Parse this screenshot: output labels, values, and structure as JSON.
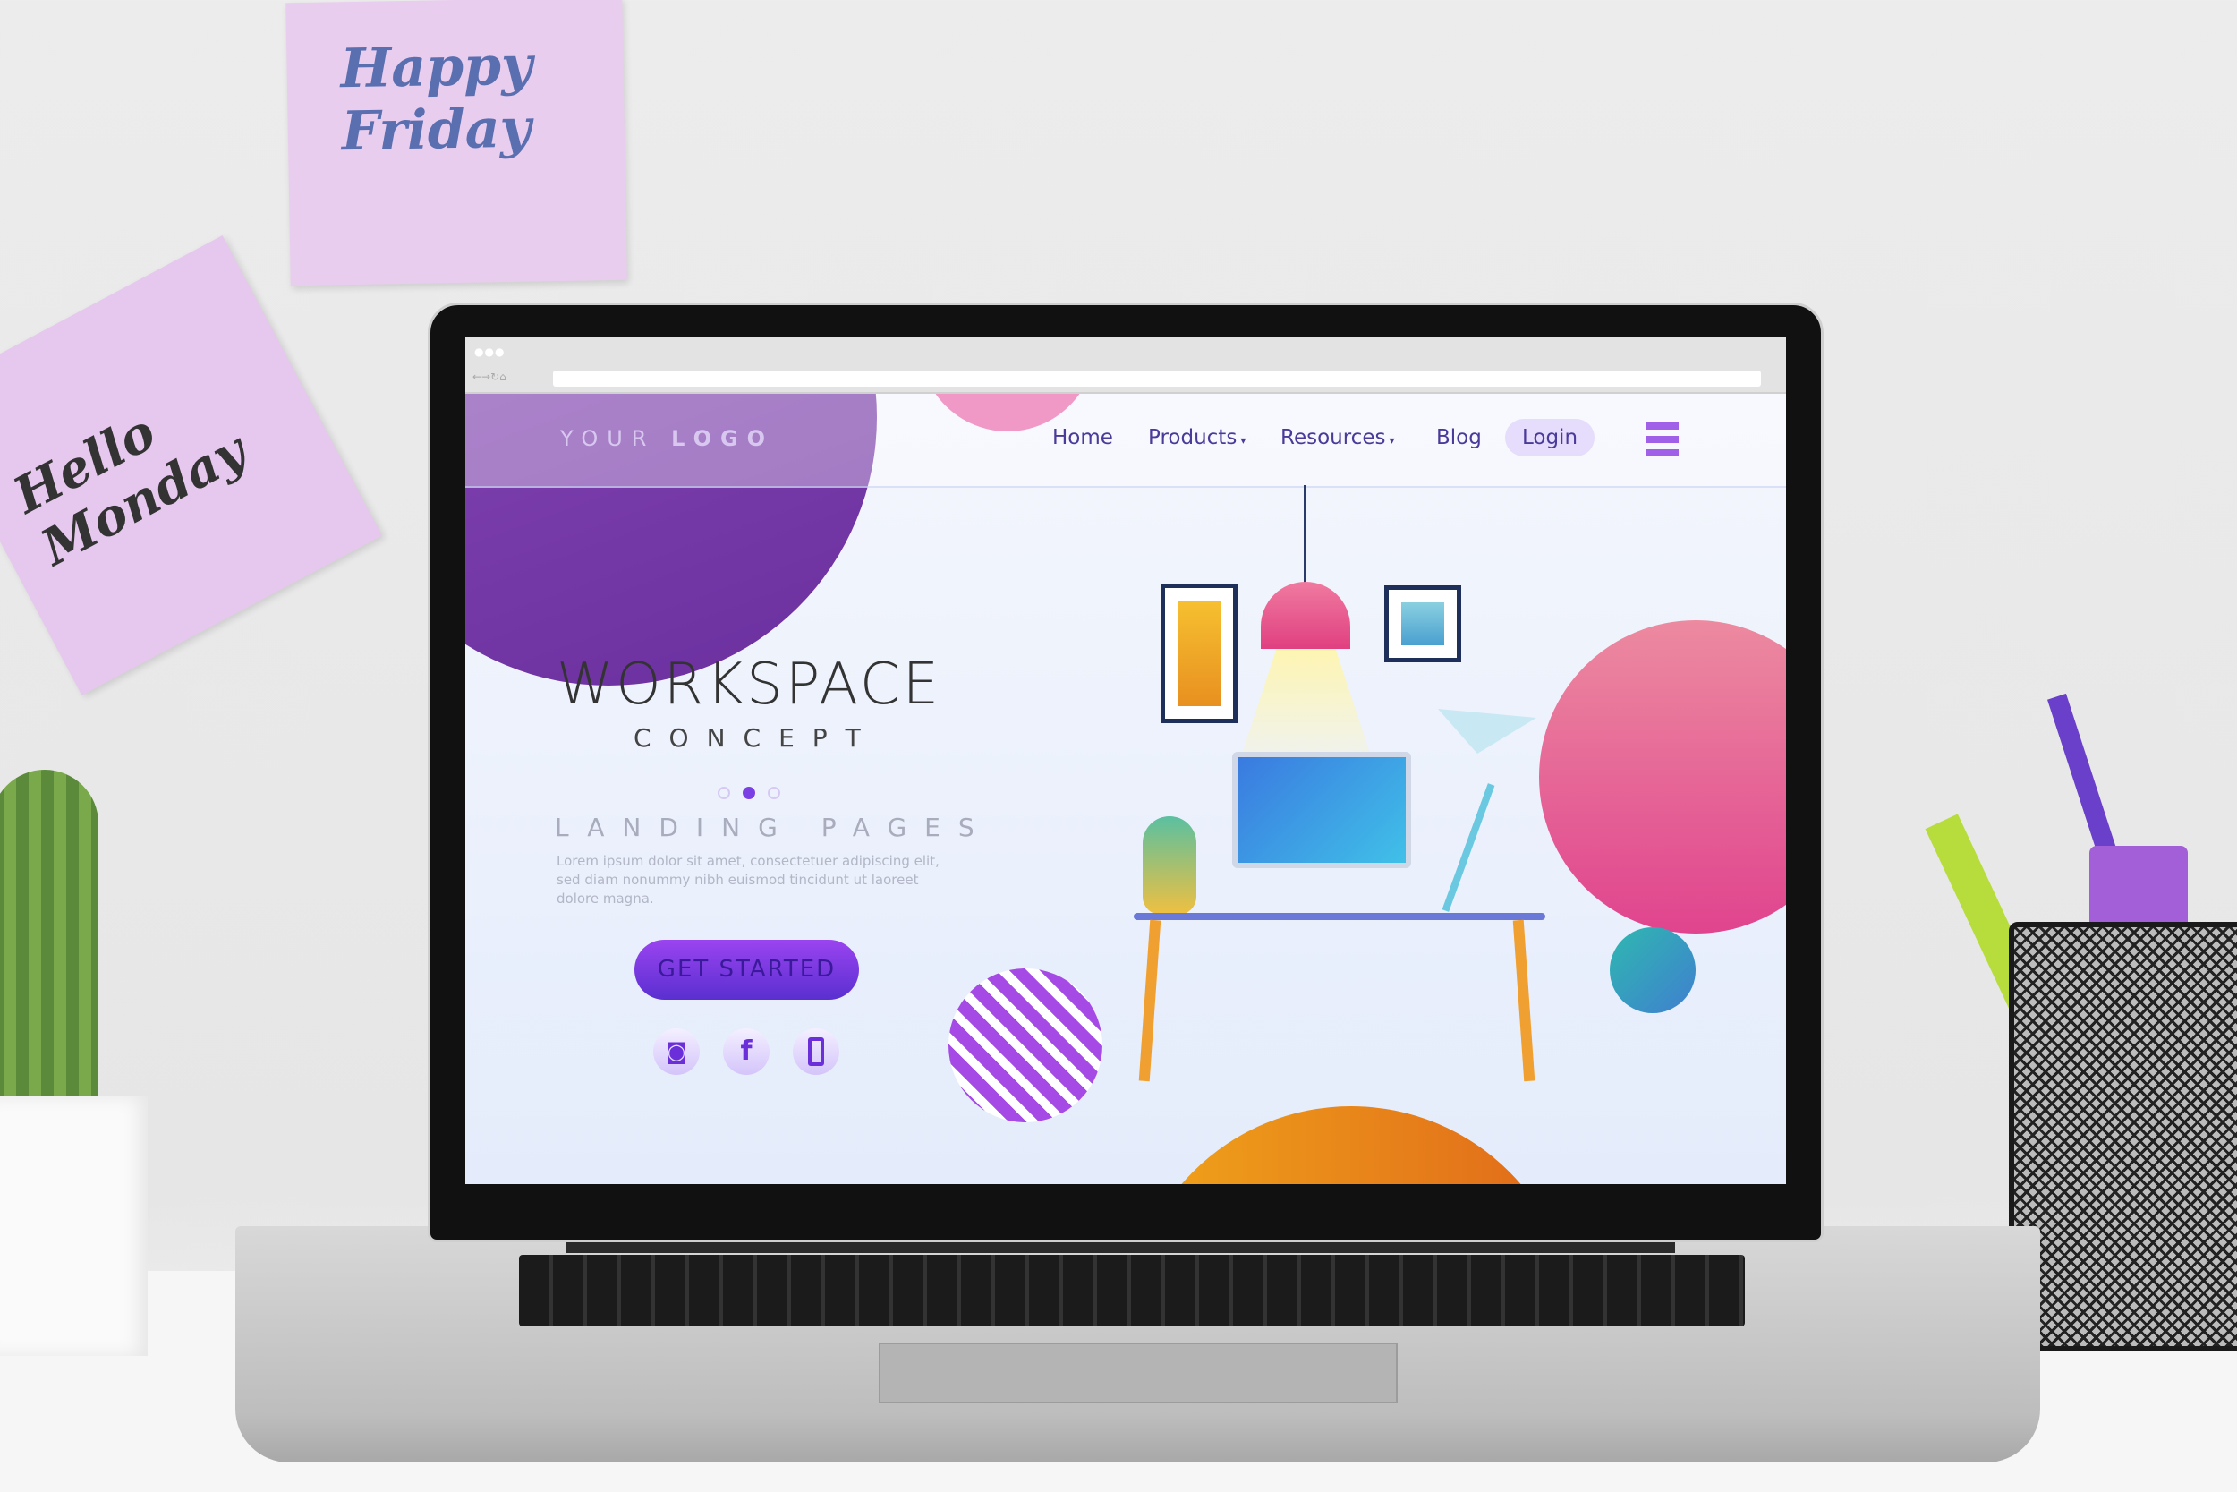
{
  "wall_notes": {
    "note1": "Happy Friday",
    "note2": "Hello Monday"
  },
  "browser": {
    "address": ""
  },
  "site": {
    "logo": {
      "part1": "YOUR",
      "part2": "LOGO"
    },
    "nav": [
      {
        "label": "Home"
      },
      {
        "label": "Products",
        "caret": "▾"
      },
      {
        "label": "Resources",
        "caret": "▾"
      },
      {
        "label": "Blog"
      }
    ],
    "login": "Login",
    "hero": {
      "title": "WORKSPACE",
      "subtitle": "CONCEPT",
      "kicker": "LANDING PAGES",
      "body": "Lorem ipsum dolor sit amet, consectetuer adipiscing elit, sed diam nonummy nibh euismod tincidunt ut laoreet dolore magna.",
      "cta": "GET STARTED",
      "carousel_active": 2,
      "carousel_count": 3
    },
    "social": [
      "instagram-icon",
      "facebook-icon",
      "phone-icon"
    ],
    "colors": {
      "accent": "#7b3fe4",
      "pink": "#e8509a",
      "orange": "#f09a1a",
      "teal": "#36a9b8"
    }
  }
}
